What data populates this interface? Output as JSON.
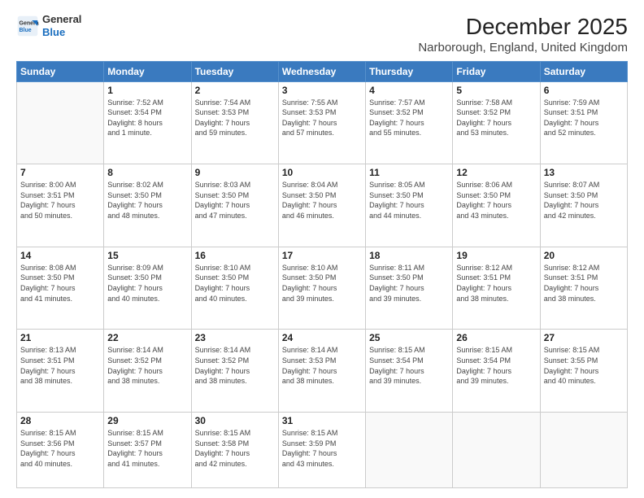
{
  "header": {
    "logo": {
      "line1": "General",
      "line2": "Blue"
    },
    "title": "December 2025",
    "subtitle": "Narborough, England, United Kingdom"
  },
  "days_of_week": [
    "Sunday",
    "Monday",
    "Tuesday",
    "Wednesday",
    "Thursday",
    "Friday",
    "Saturday"
  ],
  "weeks": [
    [
      {
        "day": "",
        "info": ""
      },
      {
        "day": "1",
        "info": "Sunrise: 7:52 AM\nSunset: 3:54 PM\nDaylight: 8 hours\nand 1 minute."
      },
      {
        "day": "2",
        "info": "Sunrise: 7:54 AM\nSunset: 3:53 PM\nDaylight: 7 hours\nand 59 minutes."
      },
      {
        "day": "3",
        "info": "Sunrise: 7:55 AM\nSunset: 3:53 PM\nDaylight: 7 hours\nand 57 minutes."
      },
      {
        "day": "4",
        "info": "Sunrise: 7:57 AM\nSunset: 3:52 PM\nDaylight: 7 hours\nand 55 minutes."
      },
      {
        "day": "5",
        "info": "Sunrise: 7:58 AM\nSunset: 3:52 PM\nDaylight: 7 hours\nand 53 minutes."
      },
      {
        "day": "6",
        "info": "Sunrise: 7:59 AM\nSunset: 3:51 PM\nDaylight: 7 hours\nand 52 minutes."
      }
    ],
    [
      {
        "day": "7",
        "info": "Sunrise: 8:00 AM\nSunset: 3:51 PM\nDaylight: 7 hours\nand 50 minutes."
      },
      {
        "day": "8",
        "info": "Sunrise: 8:02 AM\nSunset: 3:50 PM\nDaylight: 7 hours\nand 48 minutes."
      },
      {
        "day": "9",
        "info": "Sunrise: 8:03 AM\nSunset: 3:50 PM\nDaylight: 7 hours\nand 47 minutes."
      },
      {
        "day": "10",
        "info": "Sunrise: 8:04 AM\nSunset: 3:50 PM\nDaylight: 7 hours\nand 46 minutes."
      },
      {
        "day": "11",
        "info": "Sunrise: 8:05 AM\nSunset: 3:50 PM\nDaylight: 7 hours\nand 44 minutes."
      },
      {
        "day": "12",
        "info": "Sunrise: 8:06 AM\nSunset: 3:50 PM\nDaylight: 7 hours\nand 43 minutes."
      },
      {
        "day": "13",
        "info": "Sunrise: 8:07 AM\nSunset: 3:50 PM\nDaylight: 7 hours\nand 42 minutes."
      }
    ],
    [
      {
        "day": "14",
        "info": "Sunrise: 8:08 AM\nSunset: 3:50 PM\nDaylight: 7 hours\nand 41 minutes."
      },
      {
        "day": "15",
        "info": "Sunrise: 8:09 AM\nSunset: 3:50 PM\nDaylight: 7 hours\nand 40 minutes."
      },
      {
        "day": "16",
        "info": "Sunrise: 8:10 AM\nSunset: 3:50 PM\nDaylight: 7 hours\nand 40 minutes."
      },
      {
        "day": "17",
        "info": "Sunrise: 8:10 AM\nSunset: 3:50 PM\nDaylight: 7 hours\nand 39 minutes."
      },
      {
        "day": "18",
        "info": "Sunrise: 8:11 AM\nSunset: 3:50 PM\nDaylight: 7 hours\nand 39 minutes."
      },
      {
        "day": "19",
        "info": "Sunrise: 8:12 AM\nSunset: 3:51 PM\nDaylight: 7 hours\nand 38 minutes."
      },
      {
        "day": "20",
        "info": "Sunrise: 8:12 AM\nSunset: 3:51 PM\nDaylight: 7 hours\nand 38 minutes."
      }
    ],
    [
      {
        "day": "21",
        "info": "Sunrise: 8:13 AM\nSunset: 3:51 PM\nDaylight: 7 hours\nand 38 minutes."
      },
      {
        "day": "22",
        "info": "Sunrise: 8:14 AM\nSunset: 3:52 PM\nDaylight: 7 hours\nand 38 minutes."
      },
      {
        "day": "23",
        "info": "Sunrise: 8:14 AM\nSunset: 3:52 PM\nDaylight: 7 hours\nand 38 minutes."
      },
      {
        "day": "24",
        "info": "Sunrise: 8:14 AM\nSunset: 3:53 PM\nDaylight: 7 hours\nand 38 minutes."
      },
      {
        "day": "25",
        "info": "Sunrise: 8:15 AM\nSunset: 3:54 PM\nDaylight: 7 hours\nand 39 minutes."
      },
      {
        "day": "26",
        "info": "Sunrise: 8:15 AM\nSunset: 3:54 PM\nDaylight: 7 hours\nand 39 minutes."
      },
      {
        "day": "27",
        "info": "Sunrise: 8:15 AM\nSunset: 3:55 PM\nDaylight: 7 hours\nand 40 minutes."
      }
    ],
    [
      {
        "day": "28",
        "info": "Sunrise: 8:15 AM\nSunset: 3:56 PM\nDaylight: 7 hours\nand 40 minutes."
      },
      {
        "day": "29",
        "info": "Sunrise: 8:15 AM\nSunset: 3:57 PM\nDaylight: 7 hours\nand 41 minutes."
      },
      {
        "day": "30",
        "info": "Sunrise: 8:15 AM\nSunset: 3:58 PM\nDaylight: 7 hours\nand 42 minutes."
      },
      {
        "day": "31",
        "info": "Sunrise: 8:15 AM\nSunset: 3:59 PM\nDaylight: 7 hours\nand 43 minutes."
      },
      {
        "day": "",
        "info": ""
      },
      {
        "day": "",
        "info": ""
      },
      {
        "day": "",
        "info": ""
      }
    ]
  ]
}
